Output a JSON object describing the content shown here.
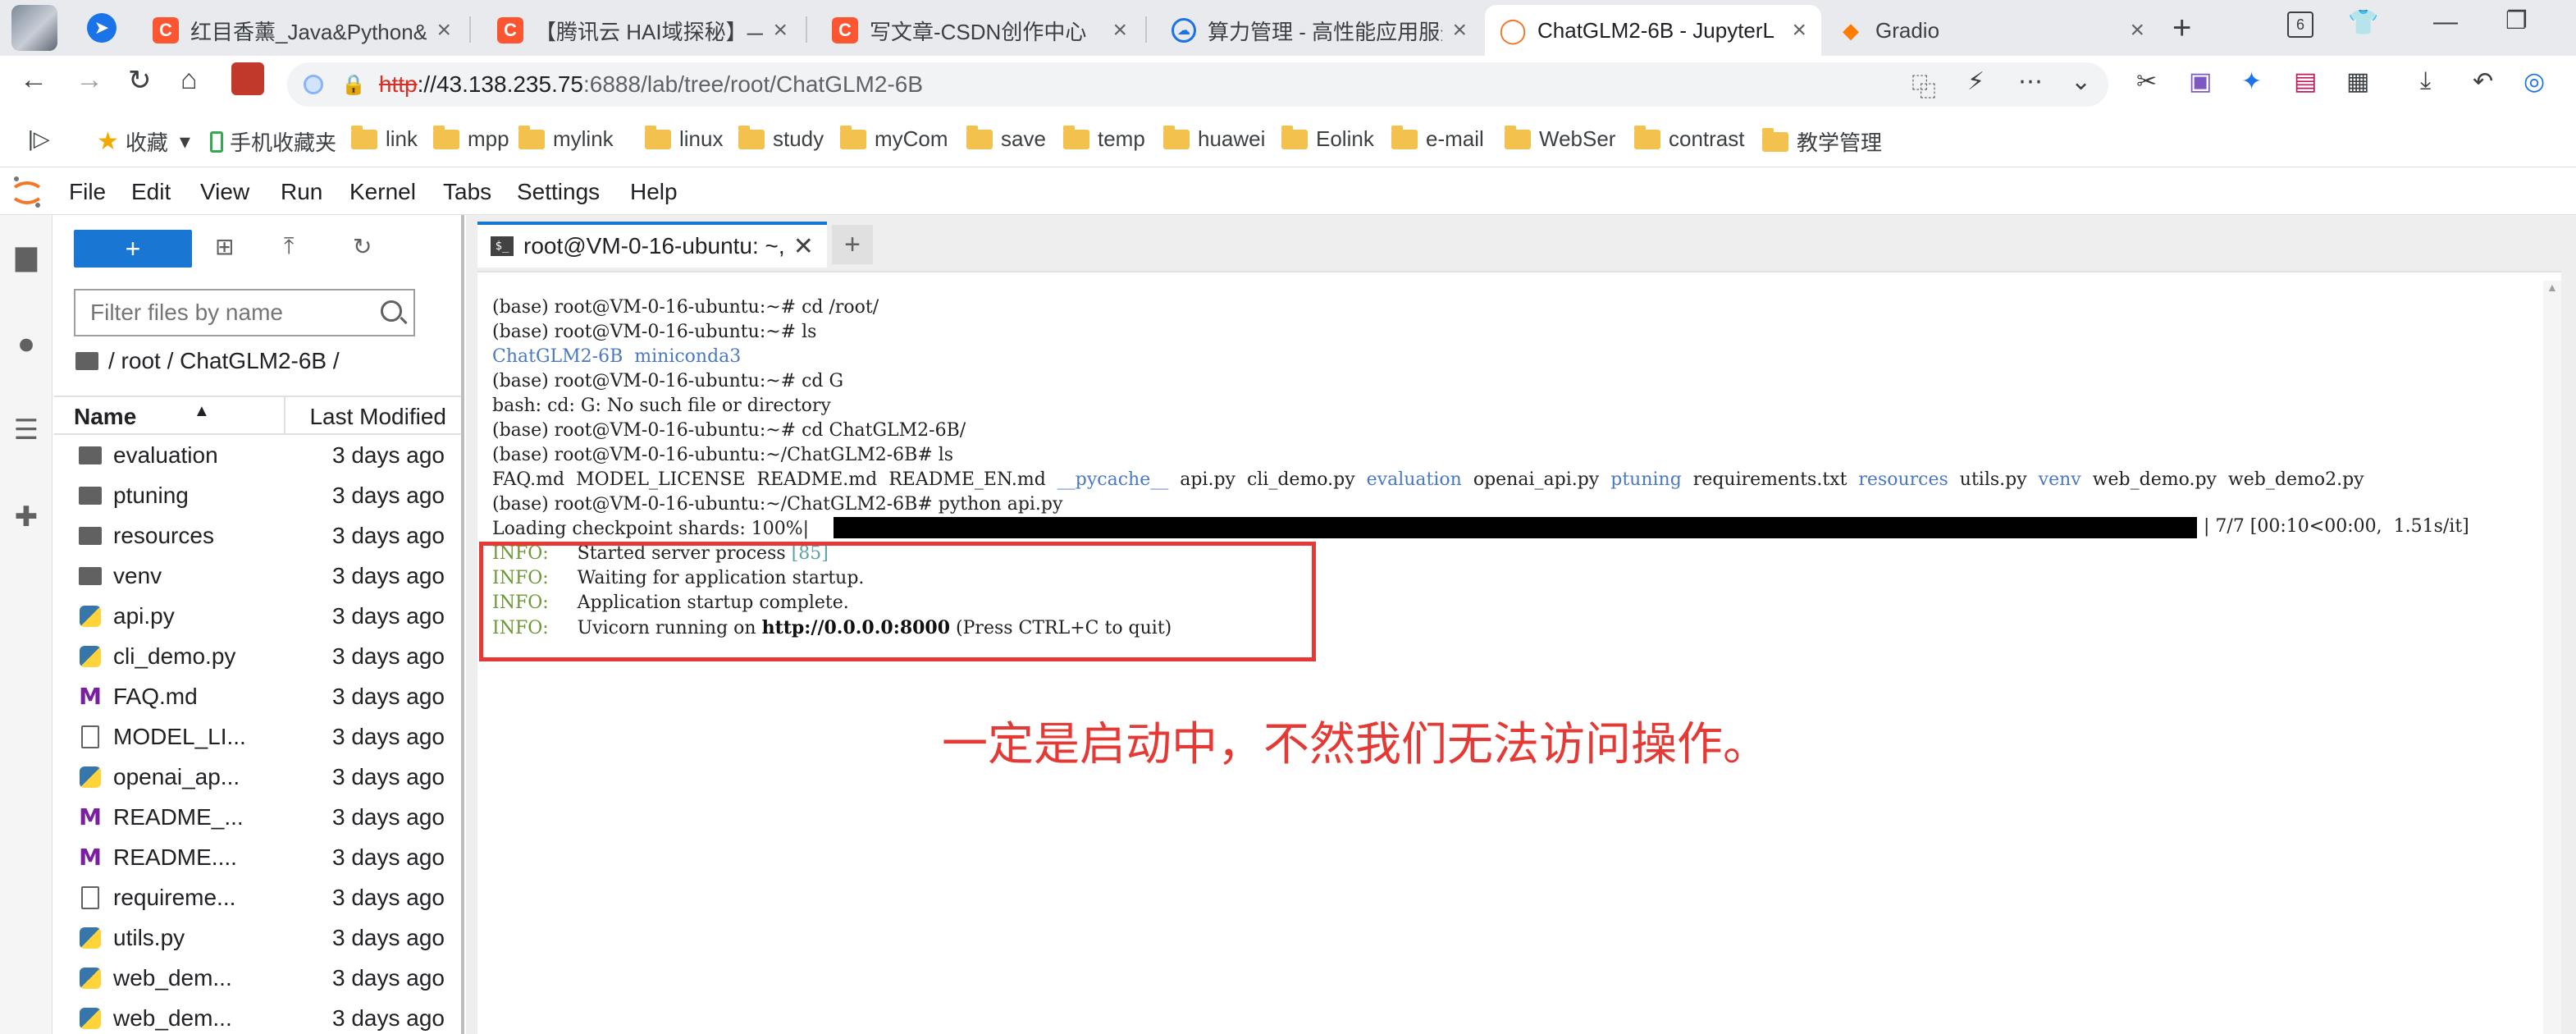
{
  "browser": {
    "tabs": [
      {
        "label": "红目香薰_Java&Python&N",
        "favicon": "csdn"
      },
      {
        "label": "【腾讯云 HAI域探秘】——",
        "favicon": "csdn"
      },
      {
        "label": "写文章-CSDN创作中心",
        "favicon": "csdn"
      },
      {
        "label": "算力管理 - 高性能应用服务",
        "favicon": "cloud"
      },
      {
        "label": "ChatGLM2-6B - JupyterL",
        "favicon": "jupyter",
        "active": true
      },
      {
        "label": "Gradio",
        "favicon": "gradio"
      }
    ],
    "tab_count": "6",
    "address": {
      "scheme": "http",
      "sep": "://",
      "host": "43.138.235.75",
      "path": ":6888/lab/tree/root/ChatGLM2-6B"
    },
    "bookmarks": [
      {
        "label": "收藏",
        "type": "star"
      },
      {
        "label": "手机收藏夹",
        "type": "phone"
      },
      {
        "label": "link",
        "type": "folder"
      },
      {
        "label": "mpp",
        "type": "folder"
      },
      {
        "label": "mylink",
        "type": "folder"
      },
      {
        "label": "linux",
        "type": "folder"
      },
      {
        "label": "study",
        "type": "folder"
      },
      {
        "label": "myCom",
        "type": "folder"
      },
      {
        "label": "save",
        "type": "folder"
      },
      {
        "label": "temp",
        "type": "folder"
      },
      {
        "label": "huawei",
        "type": "folder"
      },
      {
        "label": "Eolink",
        "type": "folder"
      },
      {
        "label": "e-mail",
        "type": "folder"
      },
      {
        "label": "WebSer",
        "type": "folder"
      },
      {
        "label": "contrast",
        "type": "folder"
      },
      {
        "label": "教学管理",
        "type": "folder"
      }
    ]
  },
  "jupyter": {
    "menu": [
      "File",
      "Edit",
      "View",
      "Run",
      "Kernel",
      "Tabs",
      "Settings",
      "Help"
    ],
    "filebrowser": {
      "new_label": "+",
      "filter_placeholder": "Filter files by name",
      "breadcrumb": "/ root / ChatGLM2-6B /",
      "col_name": "Name",
      "col_modified": "Last Modified",
      "files": [
        {
          "name": "evaluation",
          "type": "folder",
          "modified": "3 days ago"
        },
        {
          "name": "ptuning",
          "type": "folder",
          "modified": "3 days ago"
        },
        {
          "name": "resources",
          "type": "folder",
          "modified": "3 days ago"
        },
        {
          "name": "venv",
          "type": "folder",
          "modified": "3 days ago"
        },
        {
          "name": "api.py",
          "type": "python",
          "modified": "3 days ago"
        },
        {
          "name": "cli_demo.py",
          "type": "python",
          "modified": "3 days ago"
        },
        {
          "name": "FAQ.md",
          "type": "markdown",
          "modified": "3 days ago"
        },
        {
          "name": "MODEL_LI...",
          "type": "file",
          "modified": "3 days ago"
        },
        {
          "name": "openai_ap...",
          "type": "python",
          "modified": "3 days ago"
        },
        {
          "name": "README_...",
          "type": "markdown",
          "modified": "3 days ago"
        },
        {
          "name": "README....",
          "type": "markdown",
          "modified": "3 days ago"
        },
        {
          "name": "requireme...",
          "type": "file",
          "modified": "3 days ago"
        },
        {
          "name": "utils.py",
          "type": "python",
          "modified": "3 days ago"
        },
        {
          "name": "web_dem...",
          "type": "python",
          "modified": "3 days ago"
        },
        {
          "name": "web_dem...",
          "type": "python",
          "modified": "3 days ago"
        }
      ]
    },
    "terminal_tab": {
      "label": "root@VM-0-16-ubuntu: ~,"
    },
    "terminal": {
      "lines": [
        [
          {
            "t": "(base) root@VM-0-16-ubuntu:~# cd /root/"
          }
        ],
        [
          {
            "t": "(base) root@VM-0-16-ubuntu:~# ls"
          }
        ],
        [
          {
            "t": "ChatGLM2-6B  miniconda3",
            "c": "blue"
          }
        ],
        [
          {
            "t": "(base) root@VM-0-16-ubuntu:~# cd G"
          }
        ],
        [
          {
            "t": "bash: cd: G: No such file or directory"
          }
        ],
        [
          {
            "t": "(base) root@VM-0-16-ubuntu:~# cd ChatGLM2-6B/"
          }
        ],
        [
          {
            "t": "(base) root@VM-0-16-ubuntu:~/ChatGLM2-6B# ls"
          }
        ],
        [
          {
            "t": "FAQ.md  MODEL_LICENSE  README.md  README_EN.md  "
          },
          {
            "t": "__pycache__",
            "c": "blue"
          },
          {
            "t": "  api.py  cli_demo.py  "
          },
          {
            "t": "evaluation",
            "c": "blue"
          },
          {
            "t": "  openai_api.py  "
          },
          {
            "t": "ptuning",
            "c": "blue"
          },
          {
            "t": "  requirements.txt  "
          },
          {
            "t": "resources",
            "c": "blue"
          },
          {
            "t": "  utils.py  "
          },
          {
            "t": "venv",
            "c": "blue"
          },
          {
            "t": "  web_demo.py  web_demo2.py"
          }
        ],
        [
          {
            "t": "(base) root@VM-0-16-ubuntu:~/ChatGLM2-6B# python api.py"
          }
        ],
        [
          {
            "t": "Loading checkpoint shards: 100%|"
          }
        ],
        [
          {
            "t": "INFO:",
            "c": "green"
          },
          {
            "t": "     Started server process "
          },
          {
            "t": "[85]",
            "c": "teal"
          }
        ],
        [
          {
            "t": "INFO:",
            "c": "green"
          },
          {
            "t": "     Waiting for application startup."
          }
        ],
        [
          {
            "t": "INFO:",
            "c": "green"
          },
          {
            "t": "     Application startup complete."
          }
        ],
        [
          {
            "t": "INFO:",
            "c": "green"
          },
          {
            "t": "     Uvicorn running on "
          },
          {
            "t": "http://0.0.0.0:8000",
            "c": "bold"
          },
          {
            "t": " (Press CTRL+C to quit)"
          }
        ]
      ],
      "progress_fraction": 1.0,
      "progress_tail": "| 7/7 [00:10<00:00,  1.51s/it]"
    }
  },
  "annotation": "一定是启动中，不然我们无法访问操作。",
  "colors": {
    "accent": "#1976d2",
    "annotation": "#e53935",
    "tab_bg": "#e8eaed"
  }
}
